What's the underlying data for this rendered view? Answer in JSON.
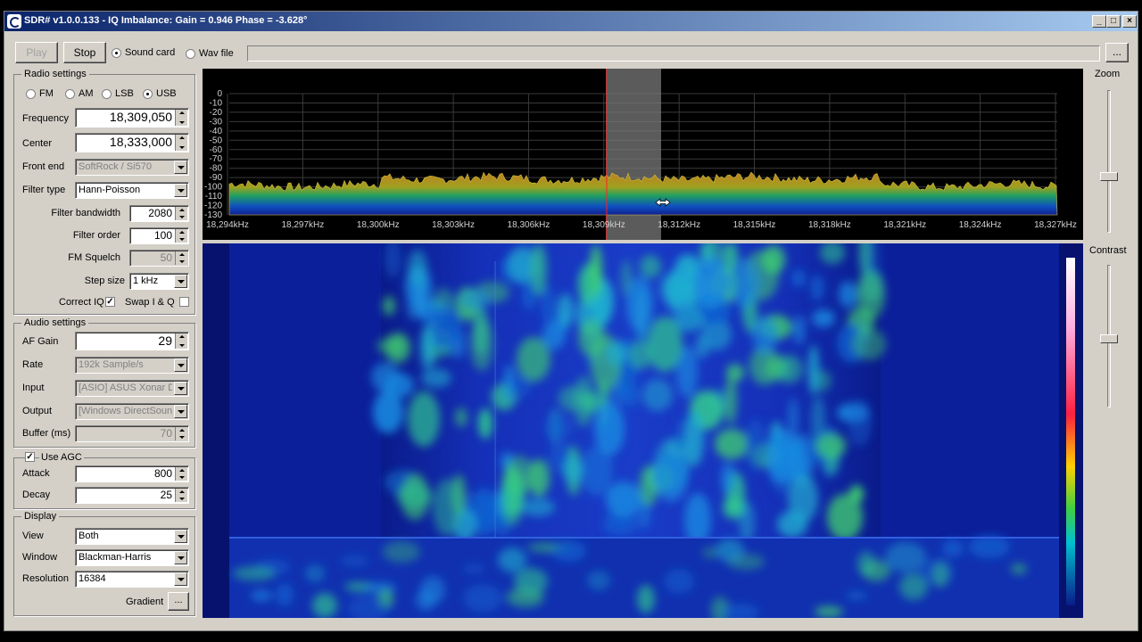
{
  "window": {
    "title": "SDR# v1.0.0.133 - IQ Imbalance: Gain = 0.946 Phase = -3.628°"
  },
  "toolbar": {
    "play_label": "Play",
    "stop_label": "Stop",
    "source_soundcard": "Sound card",
    "source_wavfile": "Wav file",
    "browse_label": "..."
  },
  "radio": {
    "title": "Radio settings",
    "modes": [
      "FM",
      "AM",
      "LSB",
      "USB"
    ],
    "selected_mode": "USB",
    "frequency_label": "Frequency",
    "frequency_value": "18,309,050",
    "center_label": "Center",
    "center_value": "18,333,000",
    "frontend_label": "Front end",
    "frontend_value": "SoftRock / Si570",
    "filtertype_label": "Filter type",
    "filtertype_value": "Hann-Poisson",
    "bandwidth_label": "Filter bandwidth",
    "bandwidth_value": "2080",
    "order_label": "Filter order",
    "order_value": "100",
    "squelch_label": "FM Squelch",
    "squelch_value": "50",
    "step_label": "Step size",
    "step_value": "1 kHz",
    "correctiq_label": "Correct IQ",
    "swapiq_label": "Swap I & Q"
  },
  "audio": {
    "title": "Audio settings",
    "afgain_label": "AF Gain",
    "afgain_value": "29",
    "rate_label": "Rate",
    "rate_value": "192k Sample/s",
    "input_label": "Input",
    "input_value": "[ASIO] ASUS Xonar D1",
    "output_label": "Output",
    "output_value": "[Windows DirectSound]",
    "buffer_label": "Buffer (ms)",
    "buffer_value": "70"
  },
  "agc": {
    "title": "Use AGC",
    "attack_label": "Attack",
    "attack_value": "800",
    "decay_label": "Decay",
    "decay_value": "25"
  },
  "display": {
    "title": "Display",
    "view_label": "View",
    "view_value": "Both",
    "window_label": "Window",
    "window_value": "Blackman-Harris",
    "resolution_label": "Resolution",
    "resolution_value": "16384",
    "gradient_label": "Gradient",
    "gradient_button": "..."
  },
  "right_panel": {
    "zoom_label": "Zoom",
    "contrast_label": "Contrast"
  },
  "spectrum": {
    "db_ticks": [
      "0",
      "-10",
      "-20",
      "-30",
      "-40",
      "-50",
      "-60",
      "-70",
      "-80",
      "-90",
      "-100",
      "-110",
      "-120",
      "-130"
    ],
    "freq_ticks": [
      "18,294kHz",
      "18,297kHz",
      "18,300kHz",
      "18,303kHz",
      "18,306kHz",
      "18,309kHz",
      "18,312kHz",
      "18,315kHz",
      "18,318kHz",
      "18,321kHz",
      "18,324kHz",
      "18,327kHz"
    ]
  },
  "colors": {
    "titlebar_start": "#0a246a",
    "titlebar_end": "#a6caf0",
    "waterfall_bg": "#06126e",
    "tuner_line": "#ff2020"
  }
}
